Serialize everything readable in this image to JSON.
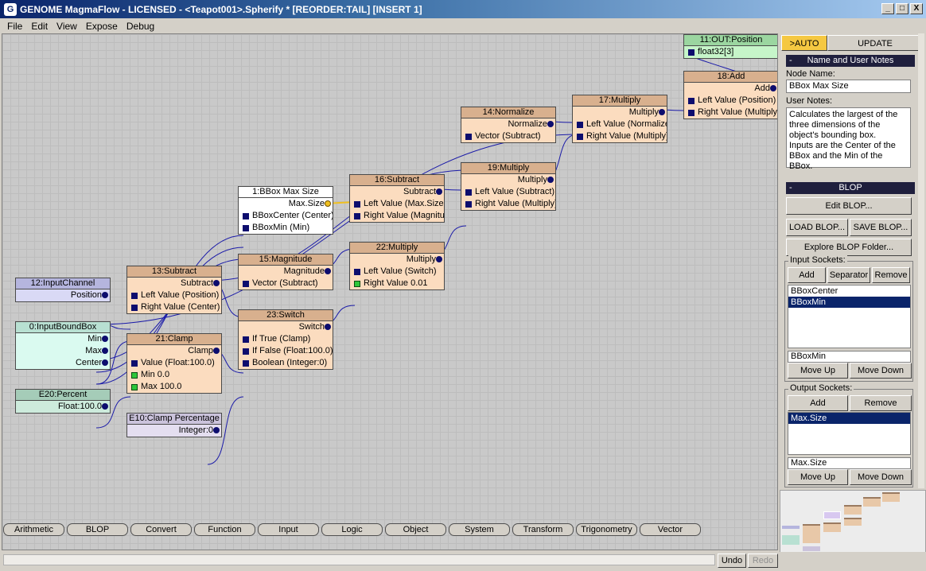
{
  "window": {
    "title": "GENOME MagmaFlow - LICENSED - <Teapot001>.Spherify *  [REORDER:TAIL] [INSERT 1]",
    "controls": {
      "min": "_",
      "max": "□",
      "close": "X"
    }
  },
  "menu": [
    "File",
    "Edit",
    "View",
    "Expose",
    "Debug"
  ],
  "nodes": {
    "n11": {
      "title": "11:OUT:Position",
      "in1": "float32[3]"
    },
    "n18": {
      "title": "18:Add",
      "out": "Add",
      "in1": "Left Value (Position)",
      "in2": "Right Value (Multiply)"
    },
    "n17": {
      "title": "17:Multiply",
      "out": "Multiply",
      "in1": "Left Value (Normalize",
      "in2": "Right Value (Multiply)"
    },
    "n14": {
      "title": "14:Normalize",
      "out": "Normalize",
      "in1": "Vector (Subtract)"
    },
    "n19": {
      "title": "19:Multiply",
      "out": "Multiply",
      "in1": "Left Value (Subtract)",
      "in2": "Right Value (Multiply)"
    },
    "n16": {
      "title": "16:Subtract",
      "out": "Subtract",
      "in1": "Left Value (Max.Size",
      "in2": "Right Value (Magnitud"
    },
    "n1": {
      "title": "1:BBox Max Size",
      "out": "Max.Size",
      "in1": "BBoxCenter (Center)",
      "in2": "BBoxMin (Min)"
    },
    "n22": {
      "title": "22:Multiply",
      "out": "Multiply",
      "in1": "Left Value (Switch)",
      "in2": "Right Value 0.01"
    },
    "n15": {
      "title": "15:Magnitude",
      "out": "Magnitude",
      "in1": "Vector (Subtract)"
    },
    "n13": {
      "title": "13:Subtract",
      "out": "Subtract",
      "in1": "Left Value (Position)",
      "in2": "Right Value (Center)"
    },
    "n12": {
      "title": "12:InputChannel",
      "out": "Position"
    },
    "n0": {
      "title": "0:InputBoundBox",
      "o1": "Min",
      "o2": "Max",
      "o3": "Center"
    },
    "n21": {
      "title": "21:Clamp",
      "out": "Clamp",
      "in1": "Value (Float:100.0)",
      "in2": "Min 0.0",
      "in3": "Max 100.0"
    },
    "n23": {
      "title": "23:Switch",
      "out": "Switch",
      "in1": "If True (Clamp)",
      "in2": "If False (Float:100.0)",
      "in3": "Boolean (Integer:0)"
    },
    "e20": {
      "title": "E20:Percent",
      "out": "Float:100.0"
    },
    "e10": {
      "title": "E10:Clamp Percentage",
      "out": "Integer:0"
    }
  },
  "panel": {
    "auto_tab": ">AUTO",
    "update_tab": "UPDATE",
    "notes_header": "Name and User Notes",
    "collapse": "-",
    "node_name_label": "Node Name:",
    "node_name_value": "BBox Max Size",
    "user_notes_label": "User Notes:",
    "user_notes_lines": [
      "Calculates the largest of the",
      "three dimensions of the",
      "object's bounding box.",
      "Inputs are the Center of the",
      "BBox and the Min of the BBox."
    ],
    "blop_header": "BLOP",
    "edit_blop": "Edit BLOP...",
    "load_blop": "LOAD BLOP...",
    "save_blop": "SAVE BLOP...",
    "explore_blop": "Explore BLOP Folder...",
    "input_sockets_label": "Input Sockets:",
    "add": "Add",
    "separator": "Separator",
    "remove": "Remove",
    "input_sockets": [
      "BBoxCenter",
      "BBoxMin"
    ],
    "input_selected_value": "BBoxMin",
    "move_up": "Move Up",
    "move_down": "Move Down",
    "output_sockets_label": "Output Sockets:",
    "output_sockets": [
      "Max.Size"
    ],
    "output_selected_value": "Max.Size"
  },
  "categories": [
    "Arithmetic",
    "BLOP",
    "Convert",
    "Function",
    "Input",
    "Logic",
    "Object",
    "System",
    "Transform",
    "Trigonometry",
    "Vector"
  ],
  "bottom": {
    "undo": "Undo",
    "redo": "Redo"
  },
  "colors": {
    "wire": "#1a1aa8",
    "socket": "#0d0d6e",
    "selected_output": "#f0c020",
    "title_bar": "#0a246a"
  }
}
